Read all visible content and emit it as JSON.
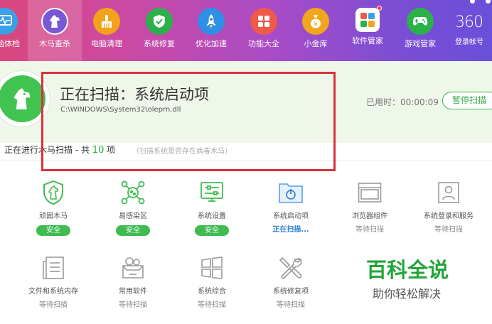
{
  "nav": {
    "items": [
      {
        "label": "电脑体检",
        "icon": "health-check-icon",
        "color": "#3aa0e8"
      },
      {
        "label": "木马查杀",
        "icon": "trojan-horse-icon",
        "color": "#7a57d6",
        "active": true
      },
      {
        "label": "电脑清理",
        "icon": "broom-icon",
        "color": "#f2a21c"
      },
      {
        "label": "系统修复",
        "icon": "shield-icon",
        "color": "#2bb14a"
      },
      {
        "label": "优化加速",
        "icon": "rocket-icon",
        "color": "#2f8fe6"
      },
      {
        "label": "功能大全",
        "icon": "grid-icon",
        "color": "#ef5b4a"
      },
      {
        "label": "小金库",
        "icon": "money-bag-icon",
        "color": "#f2a61c"
      },
      {
        "label": "软件管家",
        "icon": "apps-icon",
        "color": "#ffffff"
      },
      {
        "label": "游戏管家",
        "icon": "gamepad-icon",
        "color": "#2bb14a"
      }
    ],
    "brand_logo": "360",
    "brand_sub": "登录帐号"
  },
  "scan": {
    "title": "正在扫描：系统启动项",
    "path": "C:\\WINDOWS\\System32\\oleprn.dll",
    "elapsed_label": "已用时：00:00:09",
    "pause_label": "暂停扫描",
    "progress_prefix": "正在进行木马扫描 - 共",
    "progress_count": "10",
    "progress_suffix": "项",
    "progress_hint": "（扫描系统是否存在病毒木马）"
  },
  "items": [
    {
      "label": "顽固木马",
      "status": "安全",
      "state": "safe",
      "icon": "horse-shield-icon"
    },
    {
      "label": "易感染区",
      "status": "安全",
      "state": "safe",
      "icon": "virus-icon"
    },
    {
      "label": "系统设置",
      "status": "安全",
      "state": "safe",
      "icon": "settings-sliders-icon"
    },
    {
      "label": "系统启动项",
      "status": "正在扫描...",
      "state": "scanning",
      "icon": "startup-folder-icon"
    },
    {
      "label": "浏览器组件",
      "status": "等待扫描",
      "state": "waiting",
      "icon": "browser-window-icon"
    },
    {
      "label": "系统登录和服务",
      "status": "等待扫描",
      "state": "waiting",
      "icon": "user-card-icon"
    },
    {
      "label": "文件和系统内存",
      "status": "等待扫描",
      "state": "waiting",
      "icon": "document-icon"
    },
    {
      "label": "常用软件",
      "status": "等待扫描",
      "state": "waiting",
      "icon": "software-box-icon"
    },
    {
      "label": "系统综合",
      "status": "等待扫描",
      "state": "waiting",
      "icon": "windows-logo-icon"
    },
    {
      "label": "系统修复项",
      "status": "等待扫描",
      "state": "waiting",
      "icon": "repair-tools-icon"
    }
  ],
  "watermark": {
    "title": "百科全说",
    "subtitle": "助你轻松解决"
  },
  "colors": {
    "accent_green": "#3fbb4f",
    "scanning_blue": "#2b7fd6",
    "highlight_red": "#d8323a"
  }
}
